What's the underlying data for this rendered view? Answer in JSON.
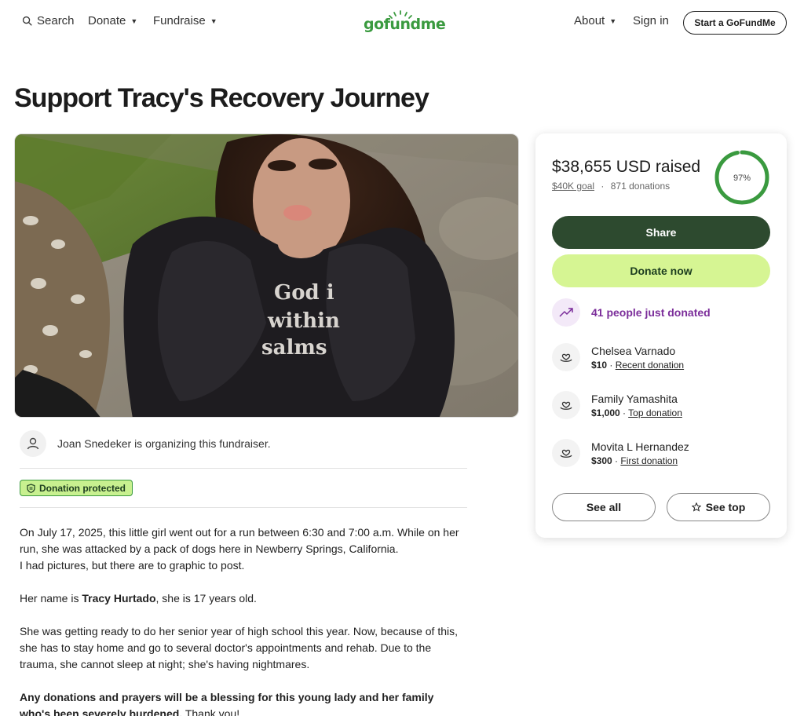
{
  "nav": {
    "search_label": "Search",
    "donate_label": "Donate",
    "fundraise_label": "Fundraise",
    "logo_text": "gofundme",
    "about_label": "About",
    "signin_label": "Sign in",
    "start_label": "Start a GoFundMe"
  },
  "page": {
    "title": "Support Tracy's Recovery Journey"
  },
  "hero": {
    "sweatshirt_text_1": "God i",
    "sweatshirt_text_2": "within",
    "sweatshirt_text_3": "salms"
  },
  "organizer": {
    "text": "Joan Snedeker is organizing this fundraiser."
  },
  "badge": {
    "label": "Donation protected"
  },
  "story": {
    "p1": "On July 17, 2025, this little girl went out for a run between 6:30 and 7:00 a.m. While on her run, she was attacked by a pack of dogs here in Newberry Springs, California.",
    "p1b": "I had pictures, but there are to graphic to post.",
    "p2_prefix": "Her name is ",
    "p2_name": "Tracy Hurtado",
    "p2_suffix": ", she is 17 years old.",
    "p3": "She was getting ready to do her senior year of high school this year. Now, because of this, she has to stay home and go to several doctor's appointments and rehab. Due to the trauma, she cannot sleep at night; she's having nightmares.",
    "p4_bold": "Any donations and prayers will be a blessing for this young lady and her family who's been severely burdened.",
    "p4_tail": " Thank you!"
  },
  "card": {
    "raised": "$38,655 USD raised",
    "goal": "$40K goal",
    "separator": "·",
    "donations": "871 donations",
    "progress_label": "97%",
    "progress_fraction": 0.97,
    "share_label": "Share",
    "donate_label": "Donate now",
    "recent_label": "41 people just donated",
    "donors": [
      {
        "name": "Chelsea Varnado",
        "amount": "$10",
        "sep": " · ",
        "tag": "Recent donation"
      },
      {
        "name": "Family Yamashita",
        "amount": "$1,000",
        "sep": " · ",
        "tag": "Top donation"
      },
      {
        "name": "Movita L Hernandez",
        "amount": "$300",
        "sep": " · ",
        "tag": "First donation"
      }
    ],
    "see_all_label": "See all",
    "see_top_label": "See top"
  },
  "colors": {
    "brand_green": "#3a9a3f",
    "share_bg": "#2d4a2f",
    "donate_bg": "#d6f593",
    "purple": "#7b2d9a",
    "ring_track": "#e4e4e4"
  },
  "icons": [
    "search-icon",
    "caret-down-icon",
    "logo-sprout-icon",
    "user-icon",
    "shield-icon",
    "trending-up-icon",
    "heart-hand-icon",
    "star-icon"
  ]
}
